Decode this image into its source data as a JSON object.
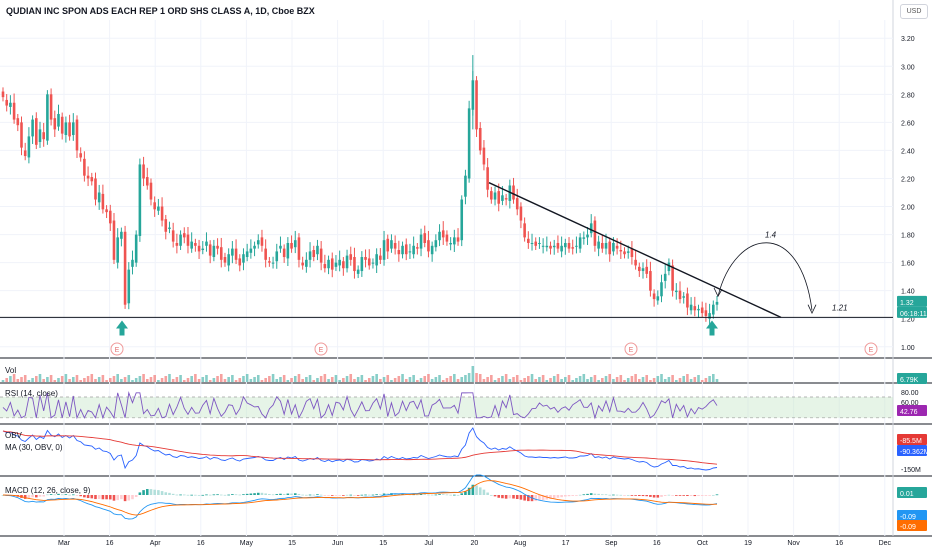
{
  "header": {
    "title": "QUDIAN INC SPON ADS EACH REP 1 ORD SHS CLASS A, 1D, Cboe BZX",
    "currency_button": "USD"
  },
  "chart_data": {
    "type": "candlestick",
    "title": "QUDIAN INC SPON ADS EACH REP 1 ORD SHS CLASS A, 1D, Cboe BZX",
    "price_axis_ticks": [
      "3.20",
      "3.00",
      "2.80",
      "2.60",
      "2.40",
      "2.20",
      "2.00",
      "1.80",
      "1.60",
      "1.40",
      "1.20",
      "1.00"
    ],
    "price_range": [
      0.92,
      3.33
    ],
    "time_axis_labels": [
      "Mar",
      "16",
      "Apr",
      "16",
      "May",
      "15",
      "Jun",
      "15",
      "Jul",
      "20",
      "Aug",
      "17",
      "Sep",
      "16",
      "Oct",
      "19",
      "Nov",
      "16",
      "Dec"
    ],
    "last_price_badge": "1.32",
    "countdown_badge": "06:18:11",
    "price_series": {
      "description": "Daily closing prices, approximate",
      "values": [
        2.78,
        2.72,
        2.74,
        2.62,
        2.58,
        2.42,
        2.36,
        2.5,
        2.62,
        2.44,
        2.55,
        2.48,
        2.8,
        2.62,
        2.55,
        2.66,
        2.52,
        2.6,
        2.5,
        2.6,
        2.4,
        2.35,
        2.22,
        2.2,
        2.18,
        2.05,
        2.1,
        1.98,
        1.96,
        1.88,
        1.62,
        1.78,
        1.82,
        1.3,
        1.55,
        1.62,
        1.8,
        2.3,
        2.2,
        2.15,
        2.05,
        1.98,
        2.0,
        1.9,
        1.82,
        1.85,
        1.75,
        1.72,
        1.8,
        1.78,
        1.72,
        1.75,
        1.72,
        1.68,
        1.7,
        1.75,
        1.65,
        1.72,
        1.7,
        1.62,
        1.6,
        1.66,
        1.7,
        1.62,
        1.58,
        1.66,
        1.68,
        1.7,
        1.72,
        1.76,
        1.72,
        1.62,
        1.6,
        1.6,
        1.68,
        1.72,
        1.64,
        1.74,
        1.7,
        1.76,
        1.62,
        1.58,
        1.62,
        1.68,
        1.64,
        1.72,
        1.6,
        1.56,
        1.62,
        1.55,
        1.6,
        1.62,
        1.56,
        1.65,
        1.62,
        1.54,
        1.55,
        1.64,
        1.62,
        1.58,
        1.6,
        1.66,
        1.62,
        1.76,
        1.68,
        1.76,
        1.7,
        1.66,
        1.72,
        1.66,
        1.68,
        1.72,
        1.7,
        1.8,
        1.74,
        1.68,
        1.72,
        1.76,
        1.82,
        1.78,
        1.75,
        1.74,
        1.78,
        1.75,
        2.05,
        2.22,
        2.7,
        2.9,
        2.55,
        2.4,
        2.3,
        2.12,
        2.05,
        2.1,
        2.02,
        2.08,
        2.05,
        2.15,
        2.05,
        1.98,
        1.9,
        1.78,
        1.74,
        1.74,
        1.72,
        1.74,
        1.72,
        1.72,
        1.7,
        1.72,
        1.7,
        1.72,
        1.74,
        1.7,
        1.7,
        1.72,
        1.78,
        1.78,
        1.8,
        1.88,
        1.72,
        1.75,
        1.7,
        1.74,
        1.66,
        1.74,
        1.7,
        1.68,
        1.66,
        1.68,
        1.64,
        1.58,
        1.54,
        1.56,
        1.52,
        1.4,
        1.34,
        1.36,
        1.46,
        1.52,
        1.6,
        1.4,
        1.4,
        1.34,
        1.36,
        1.28,
        1.3,
        1.26,
        1.27,
        1.24,
        1.22,
        1.24,
        1.3,
        1.32
      ],
      "up_color": "#26a69a",
      "down_color": "#ef5350"
    },
    "annotations": {
      "support_line_level": 1.21,
      "support_label": "1.21",
      "arc_label": "1.4",
      "earnings_markers": [
        "E",
        "E",
        "E",
        "E"
      ]
    },
    "panes": {
      "volume": {
        "label": "Vol",
        "last_value_badge": "6.79K"
      },
      "rsi": {
        "label": "RSI (14, close)",
        "ticks": [
          "80.00",
          "60.00"
        ],
        "last_value_badge": "42.76",
        "band": [
          30,
          70
        ]
      },
      "obv": {
        "label": "OBV",
        "ma_label": "MA (30, OBV, 0)",
        "ticks": [
          "-150M"
        ],
        "obv_badge": "-85.5M",
        "ma_badge": "-90.362M"
      },
      "macd": {
        "label": "MACD (12, 26, close, 9)",
        "histogram_badge": "0.01",
        "macd_badge": "-0.09",
        "signal_badge": "-0.09"
      }
    },
    "colors": {
      "up": "#26a69a",
      "down": "#ef5350",
      "rsi_line": "#7e57c2",
      "obv_line": "#2962ff",
      "obv_ma": "#e53935",
      "macd_line": "#2196f3",
      "signal_line": "#ff6d00",
      "rsi_band": "#c8e6c9"
    }
  }
}
